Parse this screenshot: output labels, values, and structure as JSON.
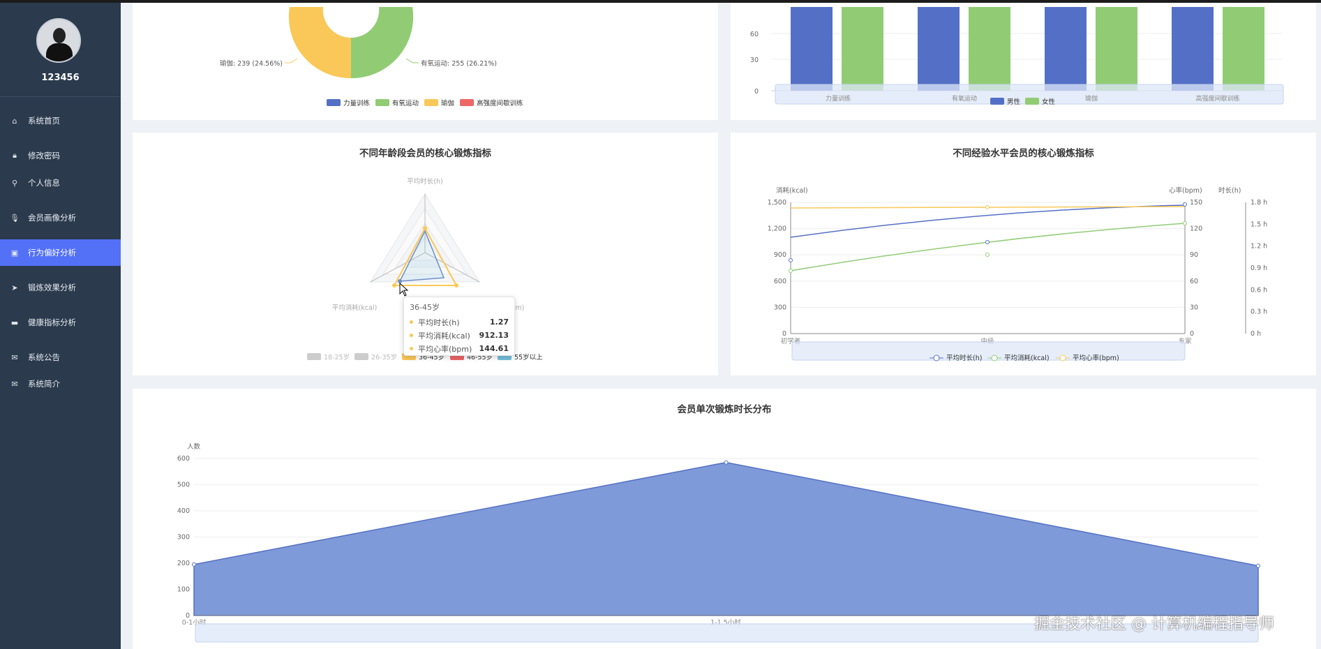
{
  "sidebar": {
    "username": "123456",
    "items": [
      {
        "label": "系统首页",
        "icon": "home-icon"
      },
      {
        "label": "修改密码",
        "icon": "lock-icon"
      },
      {
        "label": "个人信息",
        "icon": "user-icon"
      },
      {
        "label": "会员画像分析",
        "icon": "microphone-icon"
      },
      {
        "label": "行为偏好分析",
        "icon": "clipboard-icon",
        "active": true
      },
      {
        "label": "锻炼效果分析",
        "icon": "send-icon"
      },
      {
        "label": "健康指标分析",
        "icon": "monitor-icon"
      },
      {
        "label": "系统公告",
        "icon": "mail-icon"
      },
      {
        "label": "系统简介",
        "icon": "mail-icon"
      }
    ]
  },
  "colors": {
    "blue": "#5470c6",
    "green": "#91cc75",
    "yellow": "#fac858",
    "red": "#ee6666",
    "skyblue": "#73c0de",
    "active_nav": "#5371f7",
    "sidebar_bg": "#2b3a4d"
  },
  "charts": {
    "pie": {
      "labels": {
        "yoga": "瑜伽: 239 (24.56%)",
        "aerobic": "有氧运动: 255 (26.21%)"
      },
      "legend": [
        "力量训练",
        "有氧运动",
        "瑜伽",
        "高强度间歇训练"
      ]
    },
    "gender_bar": {
      "yticks": [
        "0",
        "30",
        "60"
      ],
      "categories": [
        "力量训练",
        "有氧运动",
        "瑜伽",
        "高强度间歇训练"
      ],
      "legend": [
        "男性",
        "女性"
      ]
    },
    "radar": {
      "title": "不同年龄段会员的核心锻炼指标",
      "axes": [
        "平均时长(h)",
        "平均消耗(kcal)",
        "平均心率(bpm)"
      ],
      "legend": [
        "18-25岁",
        "26-35岁",
        "36-45岁",
        "46-55岁",
        "55岁以上"
      ],
      "tooltip": {
        "title": "36-45岁",
        "rows": [
          {
            "name": "平均时长(h)",
            "value": "1.27"
          },
          {
            "name": "平均消耗(kcal)",
            "value": "912.13"
          },
          {
            "name": "平均心率(bpm)",
            "value": "144.61"
          }
        ]
      }
    },
    "experience": {
      "title": "不同经验水平会员的核心锻炼指标",
      "left_axis_name": "消耗(kcal)",
      "mid_axis_name": "心率(bpm)",
      "right_axis_name": "时长(h)",
      "left_ticks": [
        "0",
        "300",
        "600",
        "900",
        "1,200",
        "1,500"
      ],
      "mid_ticks": [
        "0",
        "30",
        "60",
        "90",
        "120",
        "150"
      ],
      "right_ticks": [
        "0 h",
        "0.3 h",
        "0.6 h",
        "0.9 h",
        "1.2 h",
        "1.5 h",
        "1.8 h"
      ],
      "categories": [
        "初学者",
        "中级",
        "专家"
      ],
      "legend": [
        "平均时长(h)",
        "平均消耗(kcal)",
        "平均心率(bpm)"
      ]
    },
    "duration": {
      "title": "会员单次锻炼时长分布",
      "yname": "人数",
      "yticks": [
        "0",
        "100",
        "200",
        "300",
        "400",
        "500",
        "600"
      ],
      "xlabels": [
        "0-1小时",
        "1-1.5小时"
      ]
    }
  },
  "chart_data": [
    {
      "type": "pie",
      "series": [
        {
          "name": "瑜伽",
          "value": 239,
          "percent": 24.56
        },
        {
          "name": "有氧运动",
          "value": 255,
          "percent": 26.21
        }
      ],
      "legend": [
        "力量训练",
        "有氧运动",
        "瑜伽",
        "高强度间歇训练"
      ]
    },
    {
      "type": "bar",
      "categories": [
        "力量训练",
        "有氧运动",
        "瑜伽",
        "高强度间歇训练"
      ],
      "series": [
        {
          "name": "男性"
        },
        {
          "name": "女性"
        }
      ],
      "yticks": [
        0,
        30,
        60
      ]
    },
    {
      "type": "radar",
      "title": "不同年龄段会员的核心锻炼指标",
      "indicators": [
        "平均时长(h)",
        "平均消耗(kcal)",
        "平均心率(bpm)"
      ],
      "series": [
        {
          "name": "36-45岁",
          "values": [
            1.27,
            912.13,
            144.61
          ]
        }
      ]
    },
    {
      "type": "line",
      "title": "不同经验水平会员的核心锻炼指标",
      "categories": [
        "初学者",
        "中级",
        "专家"
      ],
      "series": [
        {
          "name": "平均时长(h)",
          "axis": "时长(h)",
          "values": [
            0.69,
            0.85,
            1.2
          ]
        },
        {
          "name": "平均消耗(kcal)",
          "axis": "消耗(kcal)",
          "values": [
            720,
            900,
            1260
          ]
        },
        {
          "name": "平均心率(bpm)",
          "axis": "心率(bpm)",
          "values": [
            143,
            144,
            143.5
          ]
        }
      ],
      "ylim_left": [
        0,
        1500
      ],
      "ylim_mid": [
        0,
        150
      ],
      "ylim_right": [
        0,
        1.8
      ]
    },
    {
      "type": "area",
      "title": "会员单次锻炼时长分布",
      "ylabel": "人数",
      "x": [
        "0-1小时",
        "1-1.5小时",
        ""
      ],
      "values": [
        195,
        585,
        190
      ],
      "ylim": [
        0,
        600
      ]
    }
  ]
}
